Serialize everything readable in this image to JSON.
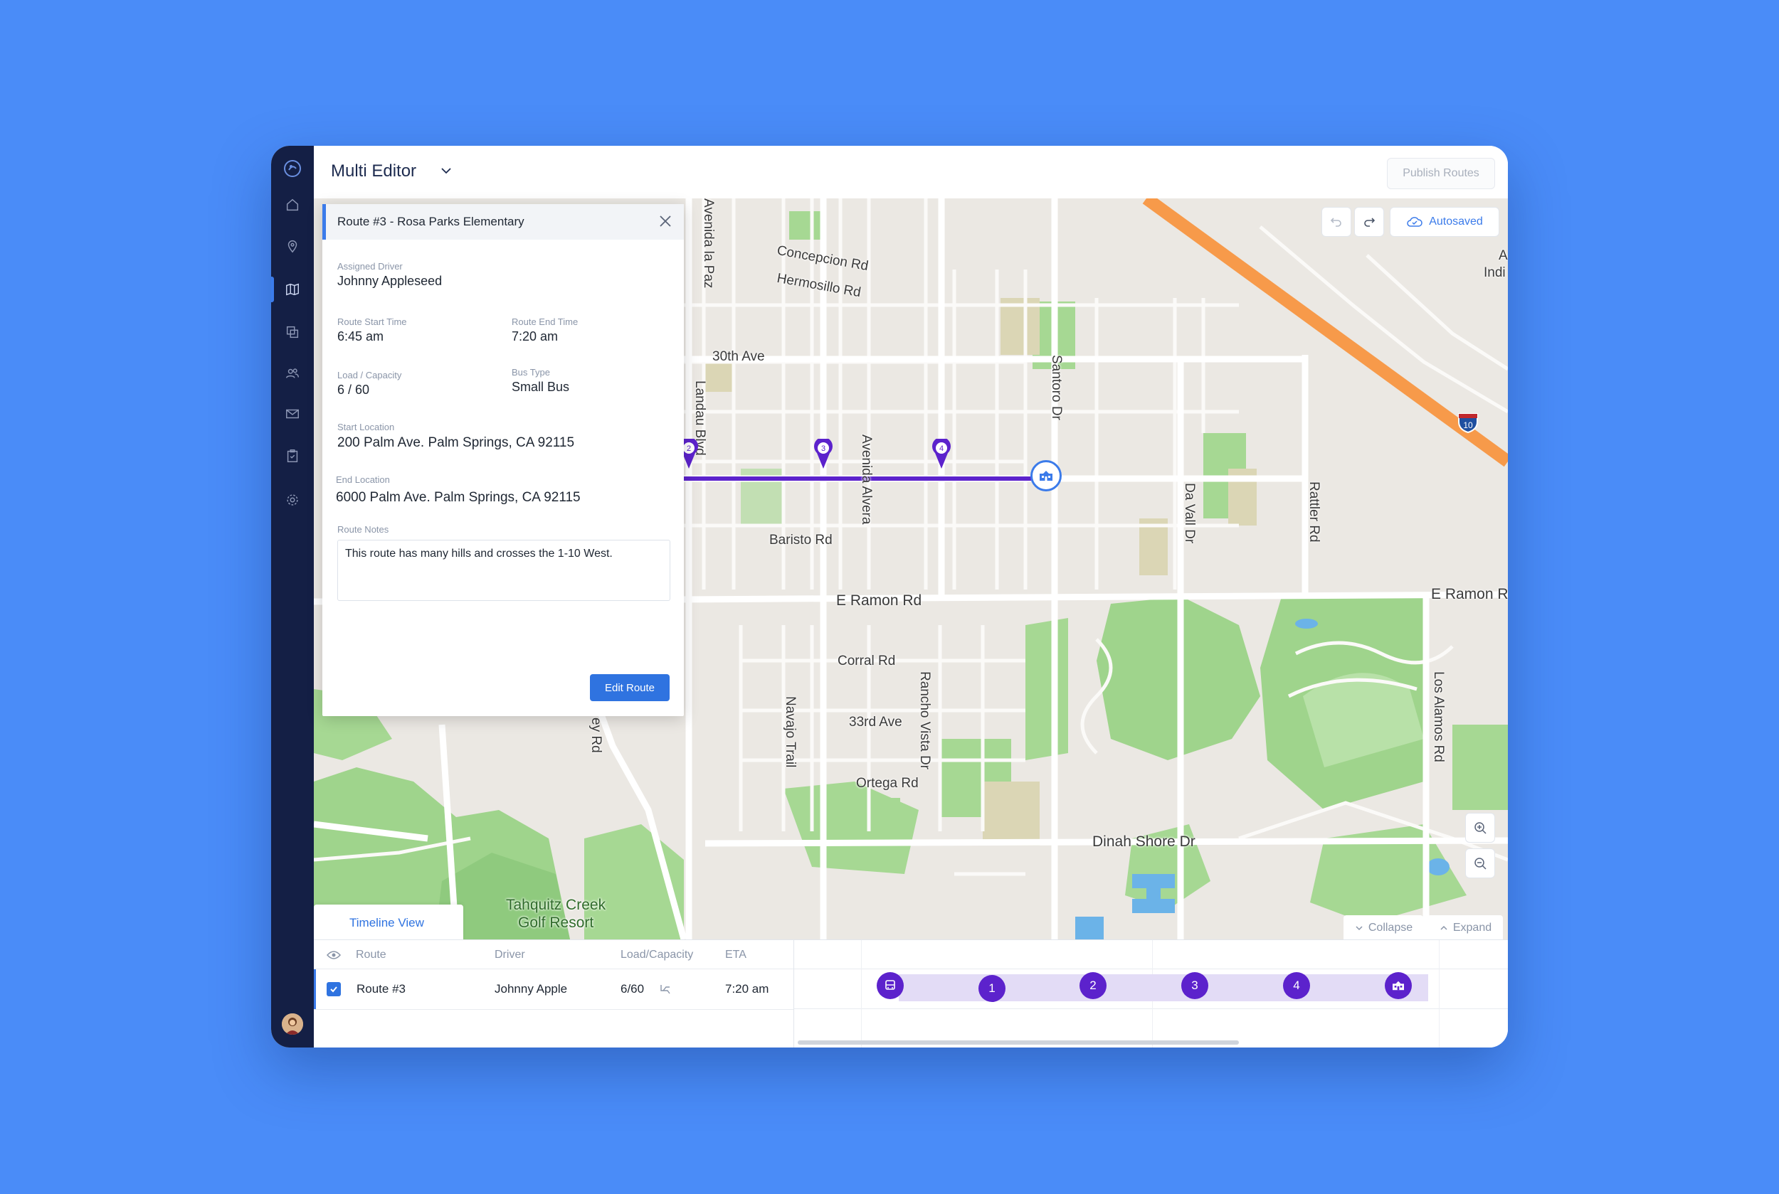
{
  "header": {
    "title": "Multi Editor",
    "publish_label": "Publish Routes"
  },
  "map": {
    "autosaved_label": "Autosaved",
    "streets": [
      "Avenida la Paz",
      "Concepcion Rd",
      "Hermosillo Rd",
      "30th Ave",
      "Landau Blvd",
      "Santoro Dr",
      "Avenida Alvera",
      "Baristo Rd",
      "Da Vall Dr",
      "Rattler Rd",
      "E Ramon Rd",
      "E Ramon Rd",
      "Corral Rd",
      "Navajo Trail",
      "33rd Ave",
      "Rancho Vista Dr",
      "Ortega Rd",
      "Los Alamos Rd",
      "Dinah Shore Dr",
      "Tahquitz Creek",
      "Golf Resort",
      "ey Rd",
      "A",
      "Indi"
    ],
    "highway_shield": "10",
    "route_stops": [
      "2",
      "3",
      "4"
    ],
    "colors": {
      "route": "#5c22cc",
      "highway": "#f79a4a",
      "accent": "#2f73e0"
    }
  },
  "panel": {
    "title": "Route #3 - Rosa Parks Elementary",
    "assigned_driver_label": "Assigned Driver",
    "assigned_driver": "Johnny Appleseed",
    "start_time_label": "Route Start Time",
    "start_time": "6:45 am",
    "end_time_label": "Route End Time",
    "end_time": "7:20 am",
    "load_label": "Load / Capacity",
    "load": "6 / 60",
    "bus_type_label": "Bus Type",
    "bus_type": "Small Bus",
    "start_location_label": "Start Location",
    "start_location": "200 Palm Ave. Palm Springs, CA 92115",
    "end_location_label": "End Location",
    "end_location": "6000 Palm Ave. Palm Springs, CA 92115",
    "notes_label": "Route Notes",
    "notes": "This route has many hills and crosses the 1-10 West.",
    "edit_button": "Edit Route"
  },
  "timeline": {
    "tab_label": "Timeline View",
    "collapse_label": "Collapse",
    "expand_label": "Expand",
    "columns": {
      "route": "Route",
      "driver": "Driver",
      "load": "Load/Capacity",
      "eta": "ETA"
    },
    "rows": [
      {
        "route": "Route #3",
        "driver": "Johnny Apple",
        "load": "6/60",
        "eta": "7:20 am",
        "checked": true
      }
    ],
    "stops": [
      "1",
      "2",
      "3",
      "4"
    ]
  }
}
